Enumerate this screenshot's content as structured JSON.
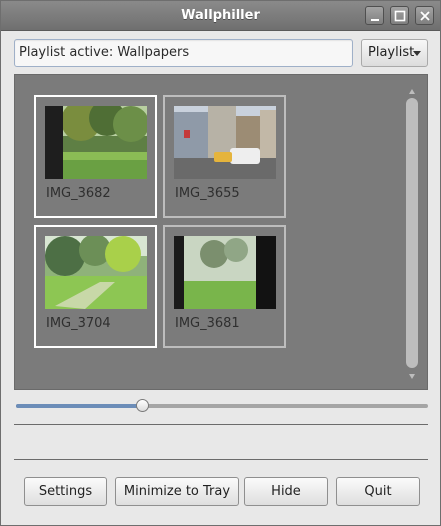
{
  "window": {
    "title": "Wallphiller"
  },
  "toolbar": {
    "status_text": "Playlist active: Wallpapers",
    "playlist_button_label": "Playlist"
  },
  "thumbnails": [
    {
      "label": "IMG_3682",
      "selected": true
    },
    {
      "label": "IMG_3655",
      "selected": false
    },
    {
      "label": "IMG_3704",
      "selected": true
    },
    {
      "label": "IMG_3681",
      "selected": false
    }
  ],
  "slider": {
    "value_fraction": 0.3
  },
  "buttons": {
    "settings": "Settings",
    "minimize_to_tray": "Minimize to Tray",
    "hide": "Hide",
    "quit": "Quit"
  },
  "colors": {
    "titlebar": "#777777",
    "thumb_area_bg": "#7b7b7b",
    "selected_border": "#ffffff",
    "unselected_border": "#bdbdbd"
  }
}
